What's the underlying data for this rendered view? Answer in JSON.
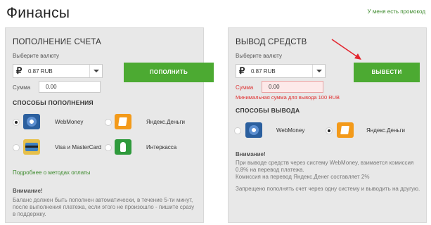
{
  "page": {
    "title": "Финансы",
    "promo_link": "У меня есть промокод"
  },
  "deposit": {
    "title": "ПОПОЛНЕНИЕ СЧЕТА",
    "currency_label": "Выберите валюту",
    "currency_symbol": "₽",
    "currency_value": "0.87 RUB",
    "amount_label": "Сумма",
    "amount_value": "0.00",
    "submit_label": "ПОПОЛНИТЬ",
    "methods_title": "СПОСОБЫ ПОПОЛНЕНИЯ",
    "methods": [
      {
        "label": "WebMoney",
        "icon": "webmoney-icon",
        "selected": true
      },
      {
        "label": "Яндекс.Деньги",
        "icon": "yandex-money-icon",
        "selected": false
      },
      {
        "label": "Visa и MasterCard",
        "icon": "bank-card-icon",
        "selected": false
      },
      {
        "label": "Интеркасса",
        "icon": "interkassa-icon",
        "selected": false
      }
    ],
    "more_link": "Подробнее о методах оплаты",
    "note_title": "Внимание!",
    "note_lines": [
      "Баланс должен быть пополнен автоматически, в течение 5-ти минут,",
      "после выполнения платежа, если этого не произошло - пишите сразу",
      "в поддержку."
    ]
  },
  "withdraw": {
    "title": "ВЫВОД СРЕДСТВ",
    "currency_label": "Выберите валюту",
    "currency_symbol": "₽",
    "currency_value": "0.87 RUB",
    "amount_label": "Сумма",
    "amount_value": "0.00",
    "error_text": "Минимальная сумма для вывода 100 RUB",
    "submit_label": "ВЫВЕСТИ",
    "methods_title": "СПОСОБЫ ВЫВОДА",
    "methods": [
      {
        "label": "WebMoney",
        "icon": "webmoney-icon",
        "selected": false
      },
      {
        "label": "Яндекс.Деньги",
        "icon": "yandex-money-icon",
        "selected": true
      }
    ],
    "note_title": "Внимание!",
    "note_lines": [
      "При выводе средств через систему WebMoney, взимается комиссия",
      "0.8% на перевод платежа.",
      "Комиссия на перевод Яндекс.Денег составляет 2%"
    ],
    "note_extra": "Запрещено пополнять счет через одну систему и выводить на другую."
  },
  "colors": {
    "accent_green": "#4caa32",
    "link_green": "#3d8a2d",
    "error_red": "#e03030",
    "panel_bg": "#e8e8e8"
  }
}
